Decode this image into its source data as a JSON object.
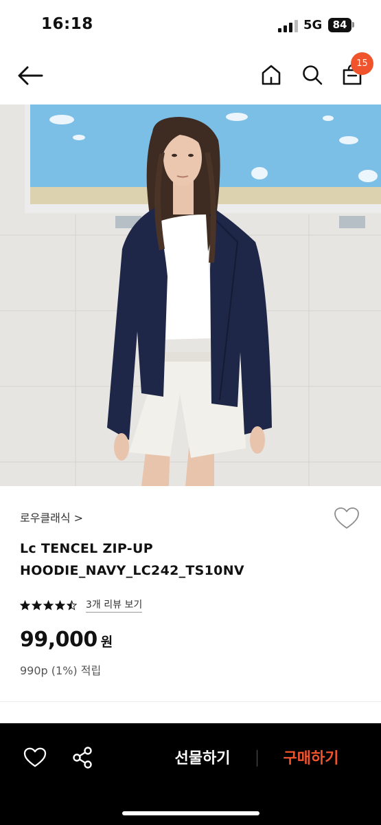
{
  "status_bar": {
    "time": "16:18",
    "network": "5G",
    "battery": "84"
  },
  "nav": {
    "cart_count": "15"
  },
  "product": {
    "brand": "로우클래식 >",
    "name": "Lc TENCEL ZIP-UP HOODIE_NAVY_LC242_TS10NV",
    "rating": 4.5,
    "review_link": "3개 리뷰 보기",
    "price": "99,000",
    "currency": "원",
    "points": "990p (1%) 적립"
  },
  "bottom_bar": {
    "gift_label": "선물하기",
    "buy_label": "구매하기"
  },
  "colors": {
    "accent": "#f0542c",
    "bottom_bar_bg": "#000000",
    "image_bg": "#e6e5e1",
    "sky": "#79bde3"
  },
  "icons": [
    "back-arrow-icon",
    "home-icon",
    "search-icon",
    "shopping-bag-icon",
    "heart-icon",
    "share-icon",
    "star-icon"
  ]
}
